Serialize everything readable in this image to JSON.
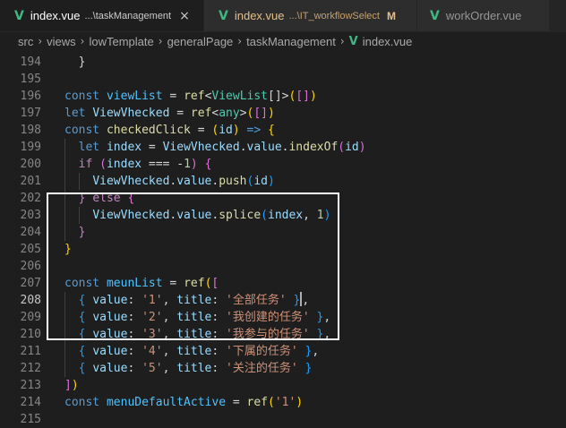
{
  "tabs": [
    {
      "name": "index.vue",
      "desc": "...\\taskManagement",
      "close": "×",
      "active": true,
      "modified": false
    },
    {
      "name": "index.vue",
      "desc": "...\\IT_workflowSelect",
      "mod": "M",
      "active": false,
      "modified": true
    },
    {
      "name": "workOrder.vue",
      "desc": "",
      "active": false,
      "modified": false
    }
  ],
  "breadcrumb": [
    "src",
    "views",
    "lowTemplate",
    "generalPage",
    "taskManagement",
    "index.vue"
  ],
  "breadcrumb_sep": "›",
  "file_icon": "V",
  "lines": [
    {
      "n": "194",
      "tokens": [
        [
          "pun",
          "  }"
        ]
      ]
    },
    {
      "n": "195",
      "tokens": []
    },
    {
      "n": "196",
      "tokens": [
        [
          "kw",
          "const "
        ],
        [
          "var",
          "viewList"
        ],
        [
          "pun",
          " = "
        ],
        [
          "fn",
          "ref"
        ],
        [
          "pun",
          "<"
        ],
        [
          "type",
          "ViewList"
        ],
        [
          "pun",
          "[]>"
        ],
        [
          "br1",
          "("
        ],
        [
          "br2",
          "["
        ],
        [
          "br2",
          "]"
        ],
        [
          "br1",
          ")"
        ]
      ]
    },
    {
      "n": "197",
      "tokens": [
        [
          "kw",
          "let "
        ],
        [
          "prop",
          "ViewVhecked"
        ],
        [
          "pun",
          " = "
        ],
        [
          "fn",
          "ref"
        ],
        [
          "pun",
          "<"
        ],
        [
          "type",
          "any"
        ],
        [
          "pun",
          ">"
        ],
        [
          "br1",
          "("
        ],
        [
          "br2",
          "["
        ],
        [
          "br2",
          "]"
        ],
        [
          "br1",
          ")"
        ]
      ]
    },
    {
      "n": "198",
      "tokens": [
        [
          "kw",
          "const "
        ],
        [
          "fn",
          "checkedClick"
        ],
        [
          "pun",
          " = "
        ],
        [
          "br1",
          "("
        ],
        [
          "prop",
          "id"
        ],
        [
          "br1",
          ")"
        ],
        [
          "pun",
          " "
        ],
        [
          "kw",
          "=>"
        ],
        [
          "pun",
          " "
        ],
        [
          "br1",
          "{"
        ]
      ]
    },
    {
      "n": "199",
      "tokens": [
        [
          "pun",
          "  "
        ],
        [
          "kw",
          "let "
        ],
        [
          "prop",
          "index"
        ],
        [
          "pun",
          " = "
        ],
        [
          "prop",
          "ViewVhecked"
        ],
        [
          "pun",
          "."
        ],
        [
          "prop",
          "value"
        ],
        [
          "pun",
          "."
        ],
        [
          "fn",
          "indexOf"
        ],
        [
          "br2",
          "("
        ],
        [
          "prop",
          "id"
        ],
        [
          "br2",
          ")"
        ]
      ]
    },
    {
      "n": "200",
      "tokens": [
        [
          "pun",
          "  "
        ],
        [
          "ctl",
          "if"
        ],
        [
          "pun",
          " "
        ],
        [
          "br2",
          "("
        ],
        [
          "prop",
          "index"
        ],
        [
          "pun",
          " === -"
        ],
        [
          "num",
          "1"
        ],
        [
          "br2",
          ")"
        ],
        [
          "pun",
          " "
        ],
        [
          "br2",
          "{"
        ]
      ]
    },
    {
      "n": "201",
      "tokens": [
        [
          "pun",
          "    "
        ],
        [
          "prop",
          "ViewVhecked"
        ],
        [
          "pun",
          "."
        ],
        [
          "prop",
          "value"
        ],
        [
          "pun",
          "."
        ],
        [
          "fn",
          "push"
        ],
        [
          "br3",
          "("
        ],
        [
          "prop",
          "id"
        ],
        [
          "br3",
          ")"
        ]
      ]
    },
    {
      "n": "202",
      "tokens": [
        [
          "pun",
          "  "
        ],
        [
          "br2",
          "}"
        ],
        [
          "pun",
          " "
        ],
        [
          "ctl",
          "else"
        ],
        [
          "pun",
          " "
        ],
        [
          "br2",
          "{"
        ]
      ]
    },
    {
      "n": "203",
      "tokens": [
        [
          "pun",
          "    "
        ],
        [
          "prop",
          "ViewVhecked"
        ],
        [
          "pun",
          "."
        ],
        [
          "prop",
          "value"
        ],
        [
          "pun",
          "."
        ],
        [
          "fn",
          "splice"
        ],
        [
          "br3",
          "("
        ],
        [
          "prop",
          "index"
        ],
        [
          "pun",
          ", "
        ],
        [
          "num",
          "1"
        ],
        [
          "br3",
          ")"
        ]
      ]
    },
    {
      "n": "204",
      "tokens": [
        [
          "pun",
          "  "
        ],
        [
          "br2",
          "}"
        ]
      ]
    },
    {
      "n": "205",
      "tokens": [
        [
          "br1",
          "}"
        ]
      ]
    },
    {
      "n": "206",
      "tokens": []
    },
    {
      "n": "207",
      "tokens": [
        [
          "kw",
          "const "
        ],
        [
          "var",
          "meunList"
        ],
        [
          "pun",
          " = "
        ],
        [
          "fn",
          "ref"
        ],
        [
          "br1",
          "("
        ],
        [
          "br2",
          "["
        ]
      ]
    },
    {
      "n": "208",
      "tokens": [
        [
          "pun",
          "  "
        ],
        [
          "br3",
          "{"
        ],
        [
          "pun",
          " "
        ],
        [
          "prop",
          "value"
        ],
        [
          "pun",
          ": "
        ],
        [
          "str",
          "'1'"
        ],
        [
          "pun",
          ", "
        ],
        [
          "prop",
          "title"
        ],
        [
          "pun",
          ": "
        ],
        [
          "str",
          "'全部任务'"
        ],
        [
          "pun",
          " "
        ],
        [
          "br3",
          "}"
        ],
        [
          "cursor",
          ""
        ],
        [
          "pun",
          ","
        ]
      ]
    },
    {
      "n": "209",
      "tokens": [
        [
          "pun",
          "  "
        ],
        [
          "br3",
          "{"
        ],
        [
          "pun",
          " "
        ],
        [
          "prop",
          "value"
        ],
        [
          "pun",
          ": "
        ],
        [
          "str",
          "'2'"
        ],
        [
          "pun",
          ", "
        ],
        [
          "prop",
          "title"
        ],
        [
          "pun",
          ": "
        ],
        [
          "str",
          "'我创建的任务'"
        ],
        [
          "pun",
          " "
        ],
        [
          "br3",
          "}"
        ],
        [
          "pun",
          ","
        ]
      ]
    },
    {
      "n": "210",
      "tokens": [
        [
          "pun",
          "  "
        ],
        [
          "br3",
          "{"
        ],
        [
          "pun",
          " "
        ],
        [
          "prop",
          "value"
        ],
        [
          "pun",
          ": "
        ],
        [
          "str",
          "'3'"
        ],
        [
          "pun",
          ", "
        ],
        [
          "prop",
          "title"
        ],
        [
          "pun",
          ": "
        ],
        [
          "str",
          "'我参与的任务'"
        ],
        [
          "pun",
          " "
        ],
        [
          "br3",
          "}"
        ],
        [
          "pun",
          ","
        ]
      ]
    },
    {
      "n": "211",
      "tokens": [
        [
          "pun",
          "  "
        ],
        [
          "br3",
          "{"
        ],
        [
          "pun",
          " "
        ],
        [
          "prop",
          "value"
        ],
        [
          "pun",
          ": "
        ],
        [
          "str",
          "'4'"
        ],
        [
          "pun",
          ", "
        ],
        [
          "prop",
          "title"
        ],
        [
          "pun",
          ": "
        ],
        [
          "str",
          "'下属的任务'"
        ],
        [
          "pun",
          " "
        ],
        [
          "br3",
          "}"
        ],
        [
          "pun",
          ","
        ]
      ]
    },
    {
      "n": "212",
      "tokens": [
        [
          "pun",
          "  "
        ],
        [
          "br3",
          "{"
        ],
        [
          "pun",
          " "
        ],
        [
          "prop",
          "value"
        ],
        [
          "pun",
          ": "
        ],
        [
          "str",
          "'5'"
        ],
        [
          "pun",
          ", "
        ],
        [
          "prop",
          "title"
        ],
        [
          "pun",
          ": "
        ],
        [
          "str",
          "'关注的任务'"
        ],
        [
          "pun",
          " "
        ],
        [
          "br3",
          "}"
        ]
      ]
    },
    {
      "n": "213",
      "tokens": [
        [
          "br2",
          "]"
        ],
        [
          "br1",
          ")"
        ]
      ]
    },
    {
      "n": "214",
      "tokens": [
        [
          "kw",
          "const "
        ],
        [
          "var",
          "menuDefaultActive"
        ],
        [
          "pun",
          " = "
        ],
        [
          "fn",
          "ref"
        ],
        [
          "br1",
          "("
        ],
        [
          "str",
          "'1'"
        ],
        [
          "br1",
          ")"
        ]
      ]
    },
    {
      "n": "215",
      "tokens": []
    }
  ],
  "current_line": "208",
  "colors": {
    "vue_icon": "#41b883",
    "highlight_box": "#ffffff",
    "background": "#1e1e1e"
  }
}
